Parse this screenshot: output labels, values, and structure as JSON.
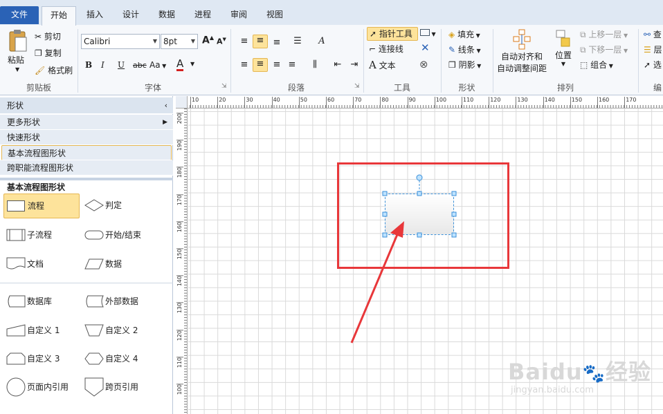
{
  "tabs": {
    "file": "文件",
    "home": "开始",
    "insert": "插入",
    "design": "设计",
    "data": "数据",
    "process": "进程",
    "review": "审阅",
    "view": "视图"
  },
  "clipboard": {
    "paste": "粘贴",
    "cut": "剪切",
    "copy": "复制",
    "format_painter": "格式刷",
    "label": "剪贴板"
  },
  "font": {
    "name": "Calibri",
    "size": "8pt",
    "label": "字体",
    "bold": "B",
    "italic": "I",
    "underline": "U",
    "strike": "abc",
    "case": "Aa",
    "color_letter": "A",
    "grow": "A",
    "shrink": "A"
  },
  "paragraph": {
    "label": "段落"
  },
  "tools": {
    "pointer": "指针工具",
    "connector": "连接线",
    "text": "文本",
    "label": "工具"
  },
  "shape_style": {
    "fill": "填充",
    "line": "线条",
    "shadow": "阴影",
    "label": "形状"
  },
  "arrange": {
    "auto_align": "自动对齐和",
    "auto_space": "自动调整间距",
    "position": "位置",
    "bring_forward": "上移一层",
    "send_backward": "下移一层",
    "group": "组合",
    "label": "排列"
  },
  "edit": {
    "find": "查",
    "layer": "层",
    "select": "选",
    "label": "编"
  },
  "pane": {
    "title": "形状",
    "more_shapes": "更多形状",
    "quick_shapes": "快速形状",
    "basic_flowchart": "基本流程图形状",
    "cross_functional": "跨职能流程图形状",
    "stencil_title": "基本流程图形状",
    "shapes": [
      "流程",
      "判定",
      "子流程",
      "开始/结束",
      "文档",
      "数据",
      "数据库",
      "外部数据",
      "自定义 1",
      "自定义 2",
      "自定义 3",
      "自定义 4",
      "页面内引用",
      "跨页引用"
    ]
  },
  "rulers": {
    "h_ticks": [
      "10",
      "20",
      "30",
      "40",
      "50",
      "60",
      "70",
      "80",
      "90",
      "100",
      "110",
      "120",
      "130",
      "140",
      "150",
      "160",
      "170"
    ],
    "v_ticks": [
      "200",
      "190",
      "180",
      "170",
      "160",
      "150",
      "140",
      "130",
      "120",
      "110",
      "100"
    ]
  },
  "watermark": {
    "brand": "Baidu",
    "brand_cn": "经验",
    "url": "jingyan.baidu.com"
  },
  "colors": {
    "accent": "#2a62b6",
    "highlight": "#fde39b",
    "annotation_red": "#e8373a",
    "handle_blue": "#3a8fd8"
  }
}
